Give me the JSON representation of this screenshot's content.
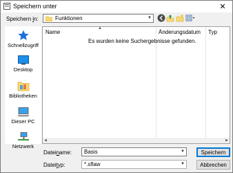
{
  "window": {
    "title": "Speichern unter"
  },
  "location": {
    "label_pre": "Speichern ",
    "label_mnemonic": "i",
    "label_post": "n:",
    "value": "Funktionen"
  },
  "toolbar": {
    "icons": [
      "back-icon",
      "up-folder-icon",
      "new-folder-icon",
      "view-menu-icon"
    ]
  },
  "sidebar": {
    "items": [
      {
        "label": "Schnellzugriff",
        "icon": "quick-access-icon"
      },
      {
        "label": "Desktop",
        "icon": "desktop-icon"
      },
      {
        "label": "Bibliotheken",
        "icon": "libraries-icon"
      },
      {
        "label": "Dieser PC",
        "icon": "this-pc-icon"
      },
      {
        "label": "Netzwerk",
        "icon": "network-icon"
      }
    ]
  },
  "filelist": {
    "columns": [
      "Name",
      "Änderungsdatum",
      "Typ"
    ],
    "empty_message": "Es wurden keine Suchergebnisse gefunden."
  },
  "filename": {
    "label_pre": "Datei",
    "label_mnemonic": "n",
    "label_post": "ame:",
    "value": "Basis"
  },
  "filetype": {
    "label_pre": "Datei",
    "label_mnemonic": "t",
    "label_post": "yp:",
    "value": "*.sflaw"
  },
  "buttons": {
    "save": "Speichern",
    "cancel": "Abbrechen"
  },
  "colors": {
    "accent": "#0078d7",
    "star": "#1e6fd9",
    "folder": "#f8d775"
  }
}
